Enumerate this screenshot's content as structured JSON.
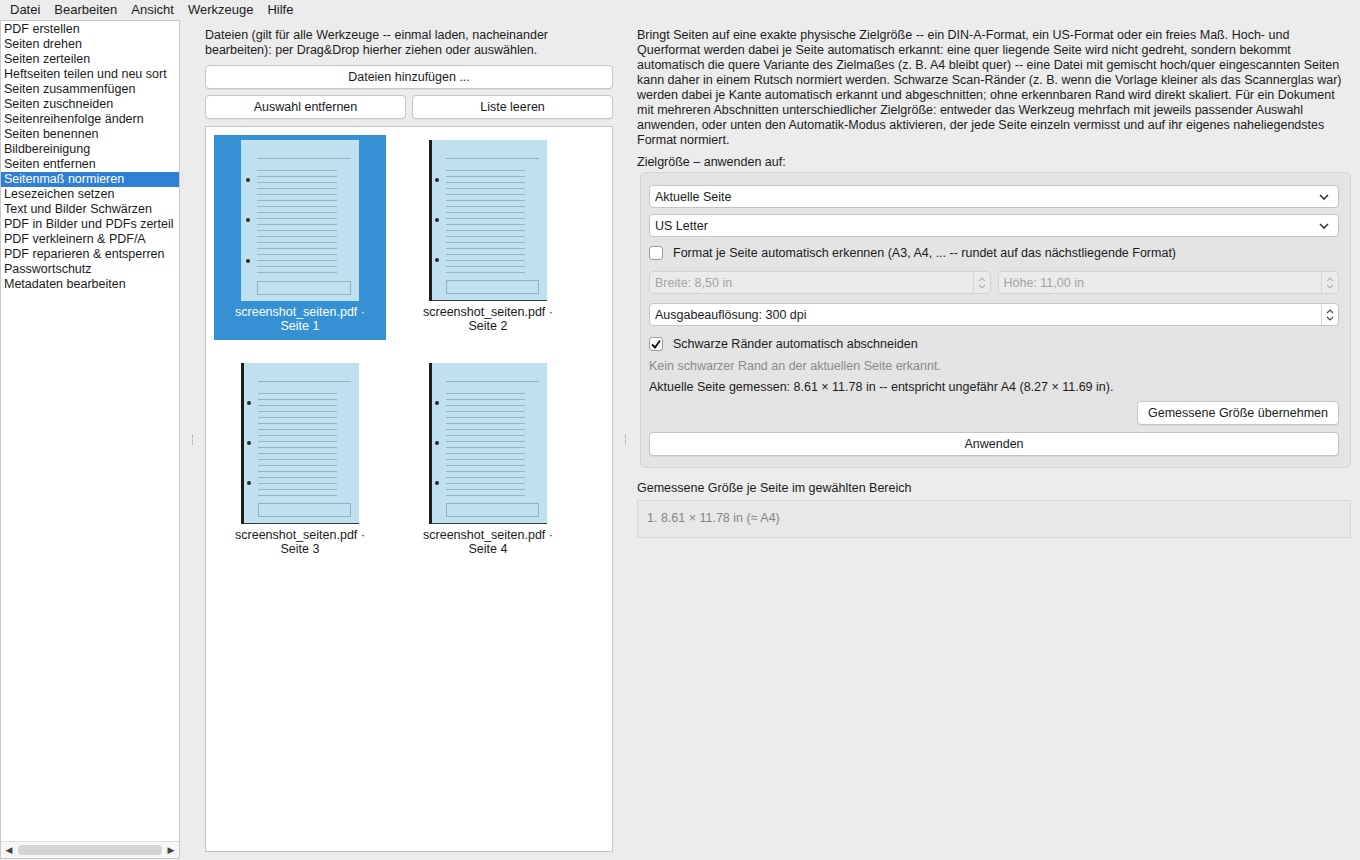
{
  "menu": [
    "Datei",
    "Bearbeiten",
    "Ansicht",
    "Werkzeuge",
    "Hilfe"
  ],
  "sidebar": {
    "items": [
      {
        "label": "PDF erstellen",
        "selected": false
      },
      {
        "label": "Seiten drehen",
        "selected": false
      },
      {
        "label": "Seiten zerteilen",
        "selected": false
      },
      {
        "label": "Heftseiten teilen und neu sort",
        "selected": false
      },
      {
        "label": "Seiten zusammenfügen",
        "selected": false
      },
      {
        "label": "Seiten zuschneiden",
        "selected": false
      },
      {
        "label": "Seitenreihenfolge ändern",
        "selected": false
      },
      {
        "label": "Seiten benennen",
        "selected": false
      },
      {
        "label": "Bildbereinigung",
        "selected": false
      },
      {
        "label": "Seiten entfernen",
        "selected": false
      },
      {
        "label": "Seitenmaß normieren",
        "selected": true
      },
      {
        "label": "Lesezeichen setzen",
        "selected": false
      },
      {
        "label": "Text und Bilder Schwärzen",
        "selected": false
      },
      {
        "label": "PDF in Bilder und PDFs zerteil",
        "selected": false
      },
      {
        "label": "PDF verkleinern & PDF/A",
        "selected": false
      },
      {
        "label": "PDF reparieren & entsperren",
        "selected": false
      },
      {
        "label": "Passwortschutz",
        "selected": false
      },
      {
        "label": "Metadaten bearbeiten",
        "selected": false
      }
    ],
    "scroll_left": "◀",
    "scroll_right": "▶"
  },
  "files": {
    "hint": "Dateien (gilt für alle Werkzeuge -- einmal laden, nacheinander bearbeiten): per Drag&Drop hierher ziehen oder auswählen.",
    "add_button": "Dateien hinzufügen ...",
    "remove_button": "Auswahl entfernen",
    "clear_button": "Liste leeren",
    "thumbnails": [
      {
        "caption": "screenshot_seiten.pdf · Seite 1",
        "selected": true
      },
      {
        "caption": "screenshot_seiten.pdf · Seite 2",
        "selected": false
      },
      {
        "caption": "screenshot_seiten.pdf · Seite 3",
        "selected": false
      },
      {
        "caption": "screenshot_seiten.pdf · Seite 4",
        "selected": false
      }
    ]
  },
  "tool": {
    "description": "Bringt Seiten auf eine exakte physische Zielgröße -- ein DIN-A-Format, ein US-Format oder ein freies Maß. Hoch- und Querformat werden dabei je Seite automatisch erkannt: eine quer liegende Seite wird nicht gedreht, sondern bekommt automatisch die quere Variante des Zielmaßes (z. B. A4 bleibt quer) -- eine Datei mit gemischt hoch/quer eingescannten Seiten kann daher in einem Rutsch normiert werden. Schwarze Scan-Ränder (z. B. wenn die Vorlage kleiner als das Scannerglas war) werden dabei je Kante automatisch erkannt und abgeschnitten; ohne erkennbaren Rand wird direkt skaliert. Für ein Dokument mit mehreren Abschnitten unterschiedlicher Zielgröße: entweder das Werkzeug mehrfach mit jeweils passender Auswahl anwenden, oder unten den Automatik-Modus aktivieren, der jede Seite einzeln vermisst und auf ihr eigenes naheliegendstes Format normiert.",
    "apply_to_label": "Zielgröße – anwenden auf:",
    "scope": "Aktuelle Seite",
    "format": "US Letter",
    "auto_format": {
      "label": "Format je Seite automatisch erkennen (A3, A4, ... -- rundet auf das nächstliegende Format)",
      "checked": false
    },
    "width": {
      "value": "Breite: 8,50 in",
      "disabled": true
    },
    "height": {
      "value": "Höhe: 11,00 in",
      "disabled": true
    },
    "resolution": {
      "value": "Ausgabeauflösung: 300 dpi",
      "disabled": false
    },
    "crop_borders": {
      "label": "Schwarze Ränder automatisch abschneiden",
      "checked": true
    },
    "border_status": "Kein schwarzer Rand an der aktuellen Seite erkannt.",
    "measured": "Aktuelle Seite gemessen: 8.61 × 11.78 in -- entspricht ungefähr A4 (8.27 × 11.69 in).",
    "take_measured_button": "Gemessene Größe übernehmen",
    "apply_button": "Anwenden",
    "per_page_label": "Gemessene Größe je Seite im gewählten Bereich",
    "per_page": [
      "1. 8.61 × 11.78 in (≈ A4)"
    ]
  }
}
